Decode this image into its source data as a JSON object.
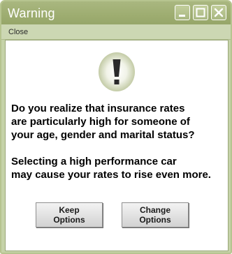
{
  "window": {
    "title": "Warning",
    "controls": [
      "minimize-icon",
      "maximize-icon",
      "close-icon"
    ]
  },
  "menu": {
    "close_label": "Close"
  },
  "dialog": {
    "icon": "exclamation-icon",
    "message_lines_1": [
      "Do you realize that insurance rates",
      "are particularly high for someone of",
      "your age, gender and marital status?"
    ],
    "message_lines_2": [
      "Selecting a high performance car",
      "may cause your rates to rise even more."
    ]
  },
  "buttons": {
    "keep": [
      "Keep",
      "Options"
    ],
    "change": [
      "Change",
      "Options"
    ]
  },
  "colors": {
    "titlebar": "#a3b176",
    "frame": "#c5d2a8",
    "text": "#000000"
  }
}
